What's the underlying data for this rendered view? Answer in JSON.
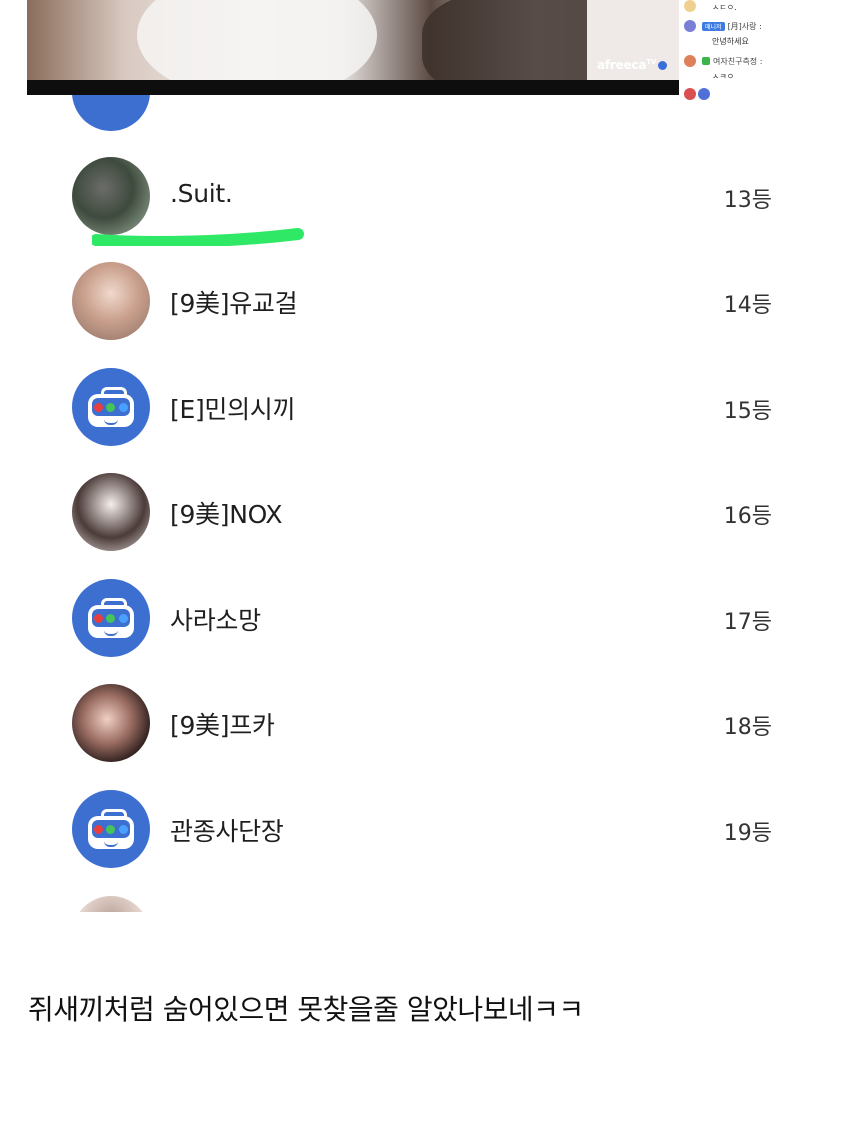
{
  "video": {
    "brand": "afreeca",
    "brand_sup": "TV"
  },
  "chat": {
    "lines": [
      {
        "text": "ㅅㄷㅇ."
      },
      {
        "badge": "매니저",
        "name": "[月]사랑 :",
        "message": "안녕하세요"
      },
      {
        "name": "여자친구측정 :",
        "message": "ㅅㅋㅇ"
      }
    ]
  },
  "ranking": {
    "items": [
      {
        "name": ".Suit.",
        "rank": "13등",
        "avatar": "photo"
      },
      {
        "name": "[9美]유교걸",
        "rank": "14등",
        "avatar": "photo"
      },
      {
        "name": "[E]민의시끼",
        "rank": "15등",
        "avatar": "default-tv-icon"
      },
      {
        "name": "[9美]NOX",
        "rank": "16등",
        "avatar": "photo"
      },
      {
        "name": "사라소망",
        "rank": "17등",
        "avatar": "default-tv-icon"
      },
      {
        "name": "[9美]프카",
        "rank": "18등",
        "avatar": "photo"
      },
      {
        "name": "관종사단장",
        "rank": "19등",
        "avatar": "default-tv-icon"
      }
    ]
  },
  "highlight_color": "#2ee866",
  "accent_color": "#3d6fd0",
  "caption": "쥐새끼처럼 숨어있으면 못찾을줄 알았나보네ㅋㅋ"
}
